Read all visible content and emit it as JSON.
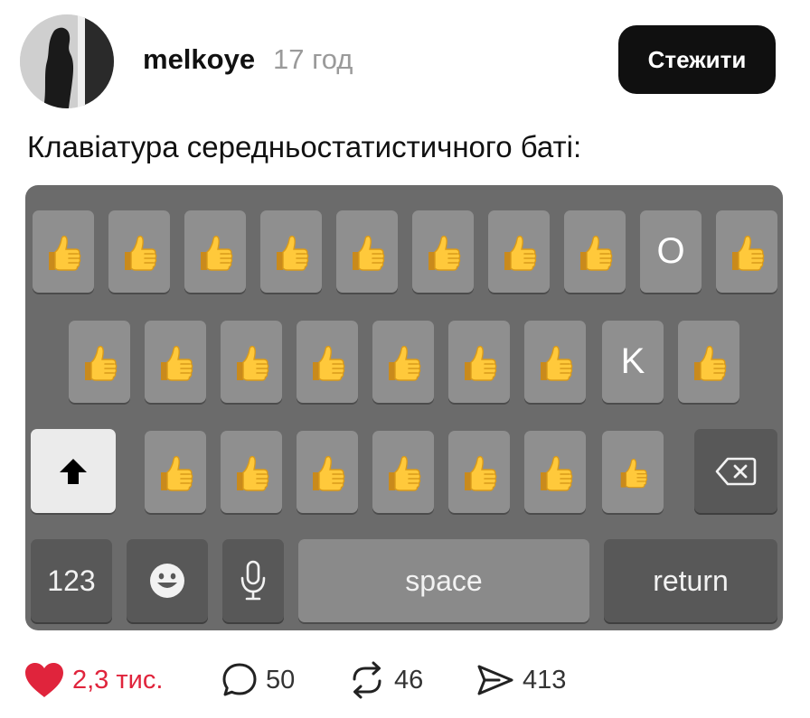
{
  "post": {
    "username": "melkoye",
    "time": "17 год",
    "follow_label": "Стежити",
    "text": "Клавіатура середньостатистичного баті:"
  },
  "keyboard": {
    "row1": [
      "thumbs-up",
      "thumbs-up",
      "thumbs-up",
      "thumbs-up",
      "thumbs-up",
      "thumbs-up",
      "thumbs-up",
      "thumbs-up",
      "O",
      "thumbs-up"
    ],
    "row2": [
      "thumbs-up",
      "thumbs-up",
      "thumbs-up",
      "thumbs-up",
      "thumbs-up",
      "thumbs-up",
      "thumbs-up",
      "K",
      "thumbs-up"
    ],
    "row3": [
      "shift",
      "thumbs-up",
      "thumbs-up",
      "thumbs-up",
      "thumbs-up",
      "thumbs-up",
      "thumbs-up",
      "thumbs-up",
      "backspace"
    ],
    "row4": {
      "num_label": "123",
      "emoji": "emoji-icon",
      "mic": "microphone-icon",
      "space_label": "space",
      "return_label": "return"
    }
  },
  "actions": {
    "likes": "2,3 тис.",
    "comments": "50",
    "reposts": "46",
    "shares": "413"
  },
  "colors": {
    "like": "#e0243c",
    "keyboard_bg": "#6b6b6b",
    "key": "#8f8f8f",
    "follow_bg": "#101010"
  }
}
